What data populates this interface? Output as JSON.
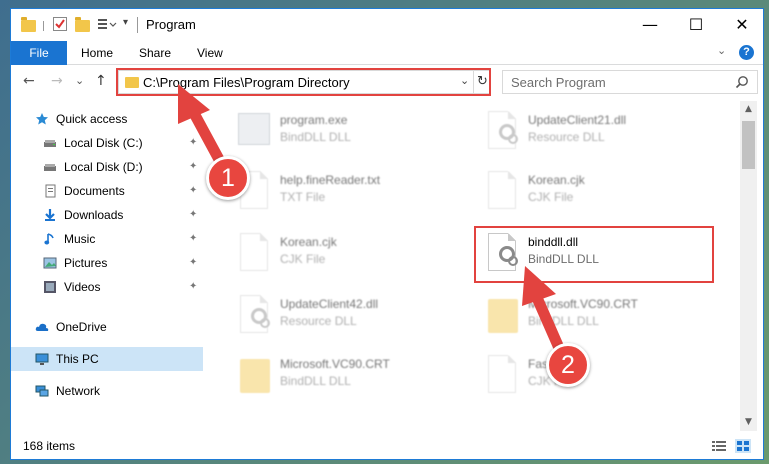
{
  "window": {
    "title": "Program",
    "minimize": "—",
    "maximize": "☐",
    "close": "✕"
  },
  "ribbon": {
    "tabs": [
      "File",
      "Home",
      "Share",
      "View"
    ],
    "help": "?"
  },
  "nav": {
    "back": "←",
    "forward": "→",
    "recent": "⌄",
    "up": "↑",
    "address": "C:\\Program Files\\Program Directory",
    "refresh": "↻",
    "search_placeholder": "Search Program"
  },
  "sidebar": {
    "items": [
      {
        "label": "Quick access",
        "icon": "star-icon",
        "pinned": false
      },
      {
        "label": "Local Disk (C:)",
        "icon": "drive-icon",
        "pinned": true
      },
      {
        "label": "Local Disk (D:)",
        "icon": "drive-icon",
        "pinned": true
      },
      {
        "label": "Documents",
        "icon": "documents-icon",
        "pinned": true
      },
      {
        "label": "Downloads",
        "icon": "download-icon",
        "pinned": true
      },
      {
        "label": "Music",
        "icon": "music-icon",
        "pinned": true
      },
      {
        "label": "Pictures",
        "icon": "pictures-icon",
        "pinned": true
      },
      {
        "label": "Videos",
        "icon": "videos-icon",
        "pinned": true
      },
      {
        "label": "OneDrive",
        "icon": "cloud-icon",
        "pinned": false
      },
      {
        "label": "This PC",
        "icon": "computer-icon",
        "pinned": false,
        "selected": true
      },
      {
        "label": "Network",
        "icon": "network-icon",
        "pinned": false
      }
    ],
    "pin_glyph": "📌"
  },
  "files": [
    {
      "name": "program.exe",
      "type": "BindDLL DLL",
      "icon": "exe-icon",
      "faded": true
    },
    {
      "name": "UpdateClient21.dll",
      "type": "Resource DLL",
      "icon": "dll-icon",
      "faded": true
    },
    {
      "name": "help.fineReader.txt",
      "type": "TXT File",
      "icon": "text-file-icon",
      "faded": true
    },
    {
      "name": "Korean.cjk",
      "type": "CJK File",
      "icon": "file-icon",
      "faded": true
    },
    {
      "name": "Korean.cjk",
      "type": "CJK File",
      "icon": "file-icon",
      "faded": true
    },
    {
      "name": "binddll.dll",
      "type": "BindDLL DLL",
      "icon": "dll-icon",
      "faded": false,
      "highlighted": true
    },
    {
      "name": "UpdateClient42.dll",
      "type": "Resource DLL",
      "icon": "dll-icon",
      "faded": true
    },
    {
      "name": "Microsoft.VC90.CRT",
      "type": "BindDLL DLL",
      "icon": "folder-icon",
      "faded": true
    },
    {
      "name": "Microsoft.VC90.CRT",
      "type": "BindDLL DLL",
      "icon": "folder-icon",
      "faded": true
    },
    {
      "name": "Fasterbk",
      "type": "CJK File",
      "icon": "file-icon",
      "faded": true
    }
  ],
  "scroll": {
    "up": "▲",
    "down": "▼"
  },
  "status": {
    "count": "168 items"
  },
  "annotations": {
    "step1": "1",
    "step2": "2",
    "color": "#e2433f"
  }
}
